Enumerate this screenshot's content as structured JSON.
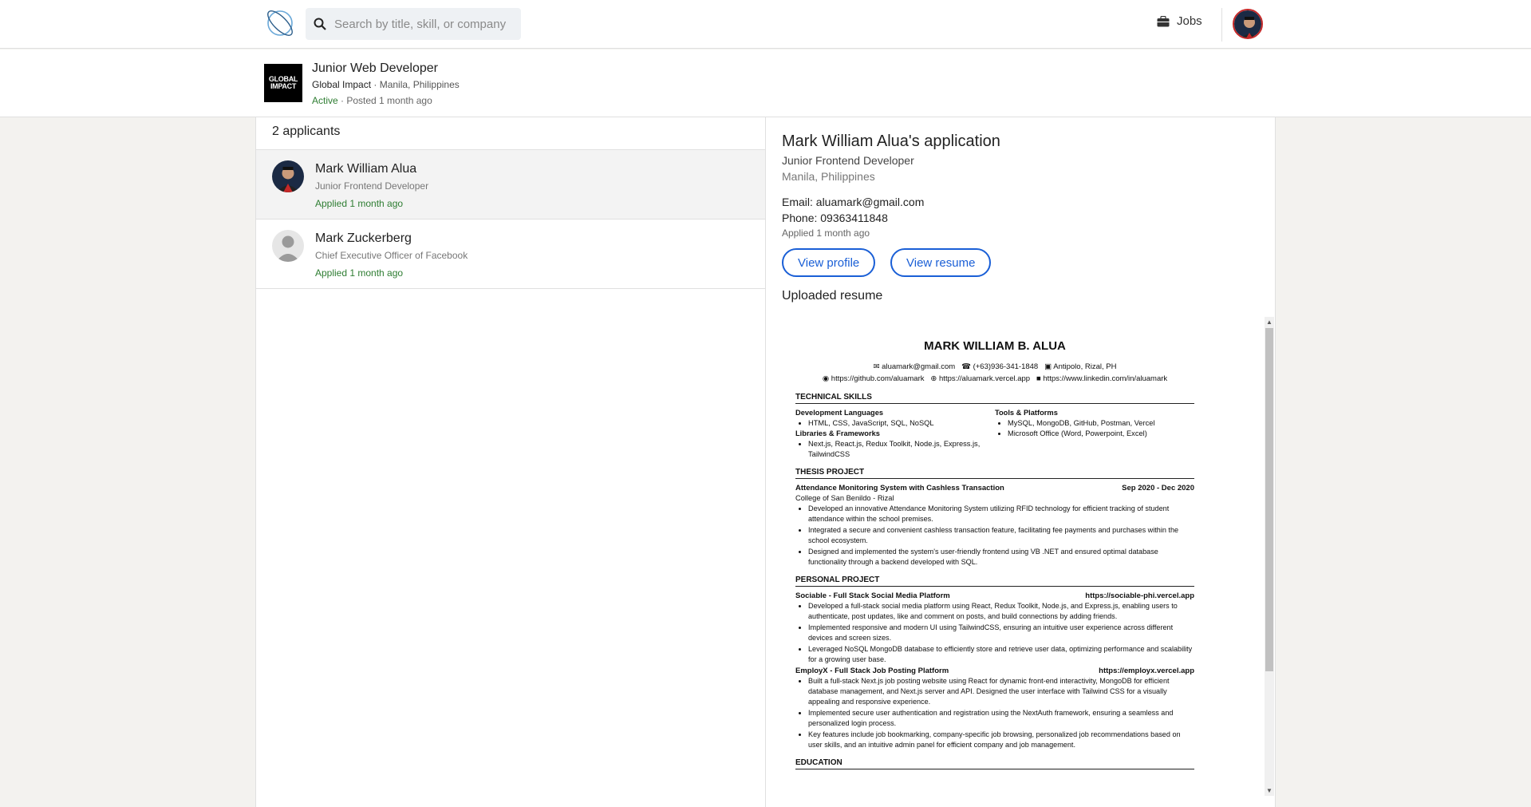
{
  "nav": {
    "search_placeholder": "Search by title, skill, or company",
    "jobs_label": "Jobs"
  },
  "job": {
    "logo_text": "GLOBAL IMPACT",
    "title": "Junior Web Developer",
    "company": "Global Impact",
    "location": " · Manila, Philippines",
    "status": "Active",
    "posted": " · Posted 1 month ago"
  },
  "applicants": {
    "count_label": "2 applicants",
    "items": [
      {
        "name": "Mark William Alua",
        "title": "Junior Frontend Developer",
        "applied": "Applied 1 month ago"
      },
      {
        "name": "Mark Zuckerberg",
        "title": "Chief Executive Officer of Facebook",
        "applied": "Applied 1 month ago"
      }
    ]
  },
  "application": {
    "heading": "Mark William Alua's application",
    "job_title": "Junior Frontend Developer",
    "location": "Manila, Philippines",
    "email": "Email: aluamark@gmail.com",
    "phone": "Phone: 09363411848",
    "applied": "Applied 1 month ago",
    "view_profile_label": "View profile",
    "view_resume_label": "View resume",
    "uploaded_label": "Uploaded resume"
  },
  "resume": {
    "name": "MARK WILLIAM B. ALUA",
    "email": "aluamark@gmail.com",
    "phone": "(+63)936-341-1848",
    "address": "Antipolo, Rizal, PH",
    "github": "https://github.com/aluamark",
    "website": "https://aluamark.vercel.app",
    "linkedin": "https://www.linkedin.com/in/aluamark",
    "skills_heading": "TECHNICAL SKILLS",
    "dev_lang_heading": "Development Languages",
    "dev_lang": "HTML, CSS, JavaScript, SQL, NoSQL",
    "libs_heading": "Libraries & Frameworks",
    "libs": "Next.js, React.js, Redux Toolkit, Node.js, Express.js, TailwindCSS",
    "tools_heading": "Tools & Platforms",
    "tools_1": "MySQL, MongoDB, GitHub, Postman, Vercel",
    "tools_2": "Microsoft Office (Word, Powerpoint, Excel)",
    "thesis_heading": "THESIS PROJECT",
    "thesis_title": "Attendance Monitoring System with Cashless Transaction",
    "thesis_dates": "Sep 2020 - Dec 2020",
    "thesis_org": "College of San Benildo - Rizal",
    "thesis_bullets": [
      "Developed an innovative Attendance Monitoring System utilizing RFID technology for efficient tracking of student attendance within the school premises.",
      "Integrated a secure and convenient cashless transaction feature, facilitating fee payments and purchases within the school ecosystem.",
      "Designed and implemented the system's user-friendly frontend using VB .NET and ensured optimal database functionality through a backend developed with SQL."
    ],
    "personal_heading": "PERSONAL PROJECT",
    "p1_title": "Sociable - Full Stack Social Media Platform",
    "p1_link": "https://sociable-phi.vercel.app",
    "p1_bullets": [
      "Developed a full-stack social media platform using React, Redux Toolkit, Node.js, and Express.js, enabling users to authenticate, post updates, like and comment on posts, and build connections by adding friends.",
      "Implemented responsive and modern UI using TailwindCSS, ensuring an intuitive user experience across different devices and screen sizes.",
      "Leveraged NoSQL MongoDB database to efficiently store and retrieve user data, optimizing performance and scalability for a growing user base."
    ],
    "p2_title": "EmployX - Full Stack Job Posting Platform",
    "p2_link": "https://employx.vercel.app",
    "p2_bullets": [
      "Built a full-stack Next.js job posting website using React for dynamic front-end interactivity, MongoDB for efficient database management, and Next.js server and API. Designed the user interface with Tailwind CSS for a visually appealing and responsive experience.",
      "Implemented secure user authentication and registration using the NextAuth framework, ensuring a seamless and personalized login process.",
      "Key features include job bookmarking, company-specific job browsing, personalized job recommendations based on user skills, and an intuitive admin panel for efficient company and job management."
    ],
    "education_heading": "EDUCATION"
  }
}
